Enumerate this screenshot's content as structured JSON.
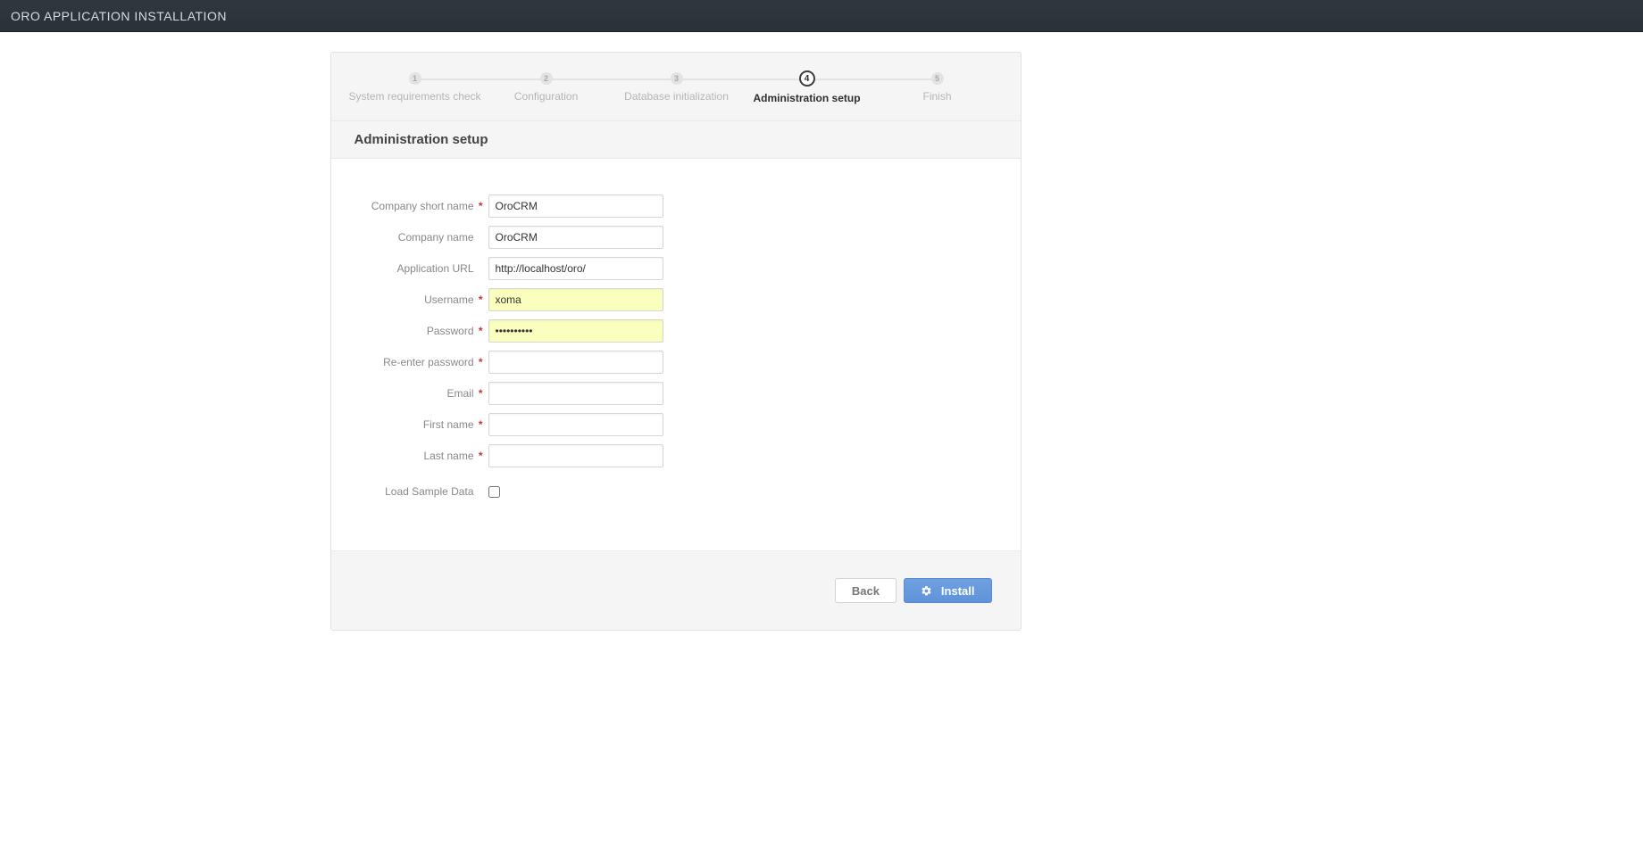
{
  "header": {
    "title": "ORO APPLICATION INSTALLATION"
  },
  "stepper": {
    "active_index": 3,
    "steps": [
      {
        "num": "1",
        "label": "System requirements check"
      },
      {
        "num": "2",
        "label": "Configuration"
      },
      {
        "num": "3",
        "label": "Database initialization"
      },
      {
        "num": "4",
        "label": "Administration setup"
      },
      {
        "num": "5",
        "label": "Finish"
      }
    ]
  },
  "section": {
    "heading": "Administration setup"
  },
  "form": {
    "company_short_name": {
      "label": "Company short name",
      "value": "OroCRM",
      "required": true
    },
    "company_name": {
      "label": "Company name",
      "value": "OroCRM",
      "required": false
    },
    "application_url": {
      "label": "Application URL",
      "value": "http://localhost/oro/",
      "required": false
    },
    "username": {
      "label": "Username",
      "value": "xoma",
      "required": true,
      "autofill": true
    },
    "password": {
      "label": "Password",
      "value": "••••••••••",
      "required": true,
      "autofill": true
    },
    "re_password": {
      "label": "Re-enter password",
      "value": "",
      "required": true
    },
    "email": {
      "label": "Email",
      "value": "",
      "required": true
    },
    "first_name": {
      "label": "First name",
      "value": "",
      "required": true
    },
    "last_name": {
      "label": "Last name",
      "value": "",
      "required": true
    },
    "load_sample": {
      "label": "Load Sample Data",
      "checked": false
    }
  },
  "footer": {
    "back_label": "Back",
    "install_label": "Install"
  }
}
